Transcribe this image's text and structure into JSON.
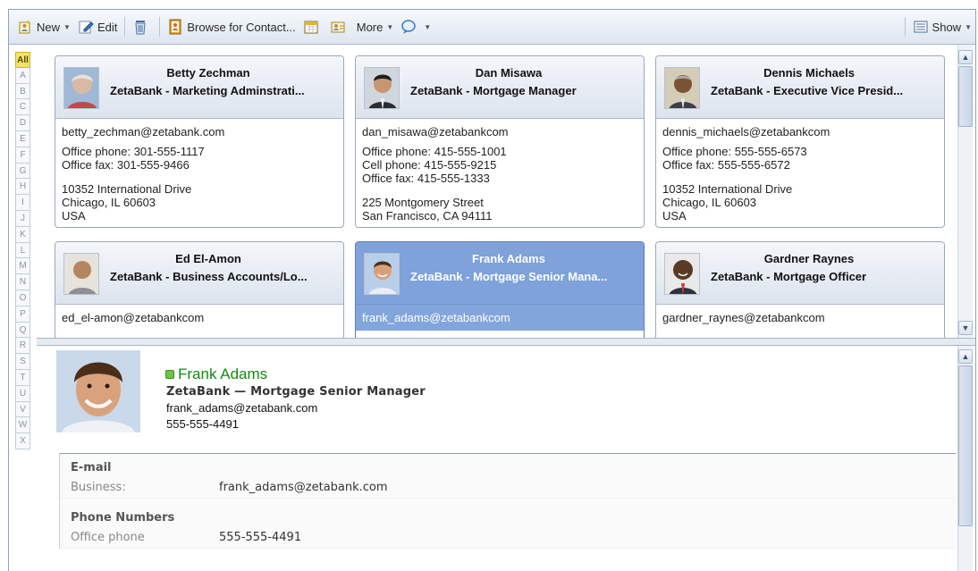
{
  "toolbar": {
    "new_label": "New",
    "edit_label": "Edit",
    "browse_label": "Browse for Contact...",
    "more_label": "More",
    "show_label": "Show"
  },
  "alpha_index": [
    "All",
    "A",
    "B",
    "C",
    "D",
    "E",
    "F",
    "G",
    "H",
    "I",
    "J",
    "K",
    "L",
    "M",
    "N",
    "O",
    "P",
    "Q",
    "R",
    "S",
    "T",
    "U",
    "V",
    "W",
    "X"
  ],
  "cards": [
    {
      "name": "Betty Zechman",
      "company": "ZetaBank - Marketing Adminstrati...",
      "email": "betty_zechman@zetabank.com",
      "phones": [
        "Office phone: 301-555-1117",
        "Office fax: 301-555-9466"
      ],
      "address": [
        "10352 International Drive",
        "Chicago, IL 60603",
        "USA"
      ]
    },
    {
      "name": "Dan Misawa",
      "company": "ZetaBank - Mortgage Manager",
      "email": "dan_misawa@zetabankcom",
      "phones": [
        "Office phone: 415-555-1001",
        "Cell phone: 415-555-9215",
        "Office fax: 415-555-1333"
      ],
      "address": [
        "225 Montgomery Street",
        "San Francisco, CA 94111"
      ]
    },
    {
      "name": "Dennis Michaels",
      "company": "ZetaBank - Executive Vice Presid...",
      "email": "dennis_michaels@zetabankcom",
      "phones": [
        "Office phone: 555-555-6573",
        "Office fax: 555-555-6572"
      ],
      "address": [
        "10352 International Drive",
        "Chicago, IL 60603",
        "USA"
      ]
    },
    {
      "name": "Ed El-Amon",
      "company": "ZetaBank - Business Accounts/Lo...",
      "email": "ed_el-amon@zetabankcom",
      "phones": [],
      "address": []
    },
    {
      "name": "Frank Adams",
      "company": "ZetaBank - Mortgage Senior Mana...",
      "email": "frank_adams@zetabankcom",
      "phones": [],
      "address": [],
      "selected": true
    },
    {
      "name": "Gardner Raynes",
      "company": "ZetaBank - Mortgage Officer",
      "email": "gardner_raynes@zetabankcom",
      "phones": [],
      "address": []
    }
  ],
  "detail": {
    "name": "Frank Adams",
    "company": "ZetaBank — Mortgage Senior Manager",
    "email": "frank_adams@zetabank.com",
    "phone": "555-555-4491",
    "email_section": {
      "title": "E-mail",
      "label": "Business:",
      "value": "frank_adams@zetabank.com"
    },
    "phone_section": {
      "title": "Phone Numbers",
      "label": "Office phone",
      "value": "555-555-4491"
    }
  },
  "colors": {
    "selected_card": "#82a6dc",
    "presence": "#6fc244",
    "detail_name": "#138a13"
  }
}
